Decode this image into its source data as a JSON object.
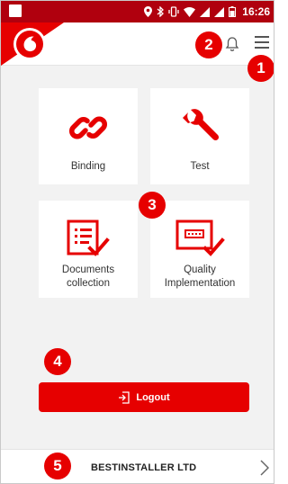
{
  "status_bar": {
    "time": "16:26",
    "icons": [
      "location-icon",
      "bluetooth-icon",
      "vibrate-icon",
      "wifi-icon",
      "signal-icon",
      "signal-icon",
      "battery-icon"
    ]
  },
  "app_bar": {
    "logo": "vodafone-logo",
    "notification_icon": "bell-icon",
    "menu_icon": "hamburger-menu-icon"
  },
  "markers": [
    "1",
    "2",
    "3",
    "4",
    "5"
  ],
  "tiles": [
    {
      "label": "Binding",
      "icon": "link-icon"
    },
    {
      "label": "Test",
      "icon": "wrench-icon"
    },
    {
      "label": "Documents\ncollection",
      "icon": "document-checklist-icon"
    },
    {
      "label": "Quality\nImplementation",
      "icon": "monitor-check-icon"
    }
  ],
  "logout": {
    "label": "Logout",
    "icon": "logout-icon"
  },
  "company": {
    "name": "BESTINSTALLER LTD",
    "icon": "chevron-right-icon"
  },
  "colors": {
    "brand_red": "#e60000",
    "status_bar": "#b0000e",
    "background": "#f2f2f2"
  }
}
